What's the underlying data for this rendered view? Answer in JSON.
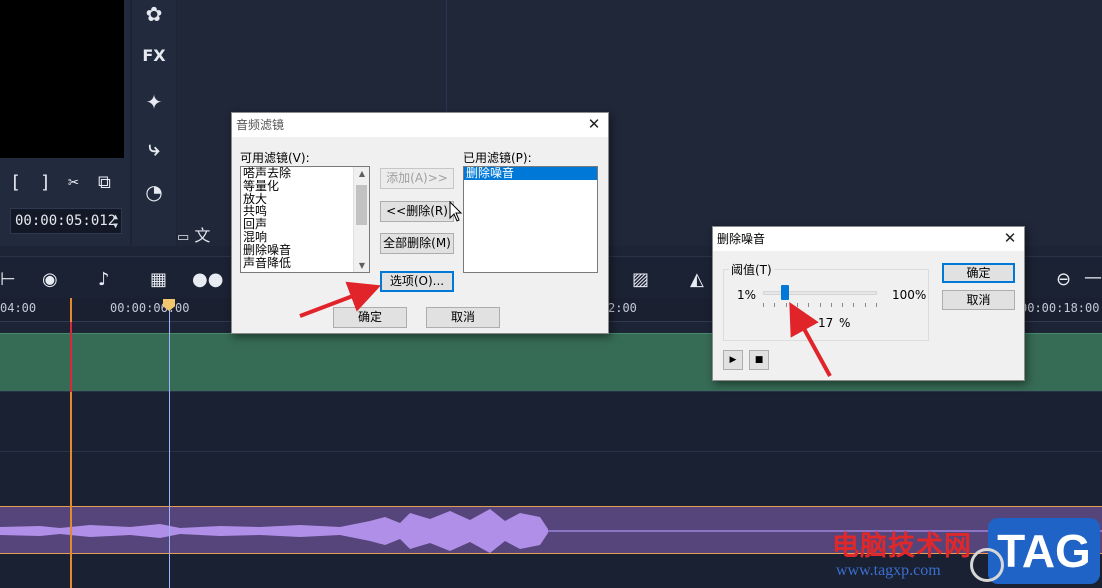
{
  "editor": {
    "preview_controls": {
      "mark_in": "[",
      "mark_out": "]",
      "split_icon": "scissors-icon",
      "copy_icon": "copy-icon"
    },
    "timecode": "00:00:05:012",
    "tools": [
      "media-icon",
      "FX",
      "magic-wand-icon",
      "path-icon",
      "gauge-icon"
    ],
    "library_bottom_label": "文",
    "ruler_labels": [
      "04:00",
      "00:00:06:00",
      "2:00",
      "00:00:18:00"
    ],
    "timeline_icons": [
      "split-audio-icon",
      "record-icon",
      "auto-music-icon",
      "storyboard-icon",
      "mix-icon",
      "motion-icon",
      "voice-icon",
      "zoom-out-icon"
    ]
  },
  "audio_filter_dialog": {
    "title": "音频滤镜",
    "available_label": "可用滤镜(V):",
    "available_items": [
      "嗒声去除",
      "等量化",
      "放大",
      "共鸣",
      "回声",
      "混响",
      "删除噪音",
      "声音降低"
    ],
    "applied_label": "已用滤镜(P):",
    "applied_items": [
      "删除噪音"
    ],
    "add_button": "添加(A)>>",
    "remove_button": "<<删除(R)",
    "remove_all_button": "全部删除(M)",
    "options_button": "选项(O)...",
    "ok_button": "确定",
    "cancel_button": "取消"
  },
  "noise_dialog": {
    "title": "删除噪音",
    "group_label": "阈值(T)",
    "min_label": "1%",
    "max_label": "100%",
    "value": "17",
    "unit": "%",
    "threshold_fraction": 0.17,
    "ok_button": "确定",
    "cancel_button": "取消",
    "play_icon": "▶",
    "stop_icon": "■"
  },
  "watermark": {
    "site_name": "电脑技术网",
    "url": "www.tagxp.com",
    "logo": "TAG"
  },
  "colors": {
    "video_track": "#366b55",
    "audio_track": "#56457a",
    "accent": "#0078d7",
    "annotation_arrow": "#e0242a"
  }
}
